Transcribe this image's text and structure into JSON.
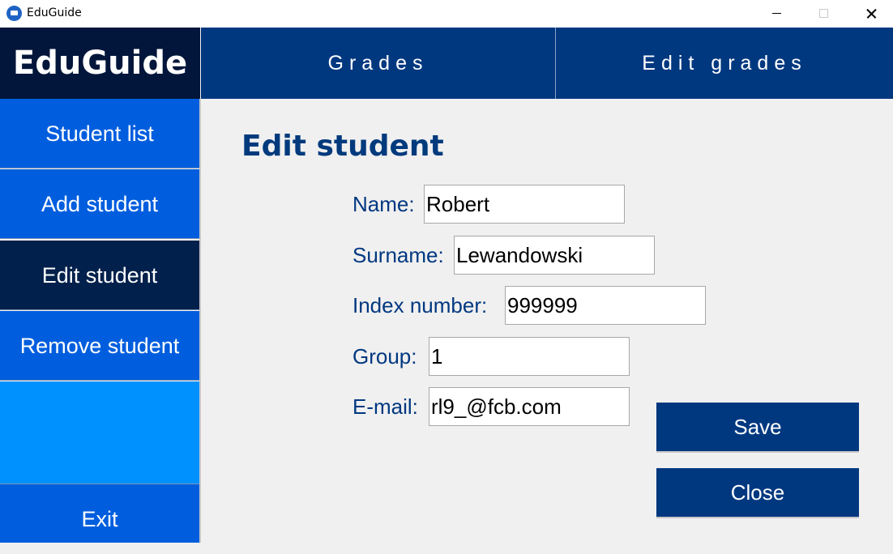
{
  "window": {
    "title": "EduGuide"
  },
  "sidebar": {
    "logo": "EduGuide",
    "items": [
      {
        "label": "Student list"
      },
      {
        "label": "Add student"
      },
      {
        "label": "Edit student"
      },
      {
        "label": "Remove student"
      }
    ],
    "exit_label": "Exit"
  },
  "topnav": {
    "tabs": [
      {
        "label": "Grades"
      },
      {
        "label": "Edit grades"
      }
    ]
  },
  "form": {
    "title": "Edit student",
    "fields": {
      "name": {
        "label": "Name:",
        "value": "Robert"
      },
      "surname": {
        "label": "Surname:",
        "value": "Lewandowski"
      },
      "index": {
        "label": "Index number:",
        "value": "999999"
      },
      "group": {
        "label": "Group:",
        "value": "1"
      },
      "email": {
        "label": "E-mail:",
        "value": "rl9_@fcb.com"
      }
    },
    "save_label": "Save",
    "close_label": "Close"
  },
  "colors": {
    "accent": "#003880",
    "sidebar": "#005ede",
    "sidebar_active": "#01204b",
    "sidebar_filler": "#0191ff",
    "logo_bg": "#01163a"
  }
}
